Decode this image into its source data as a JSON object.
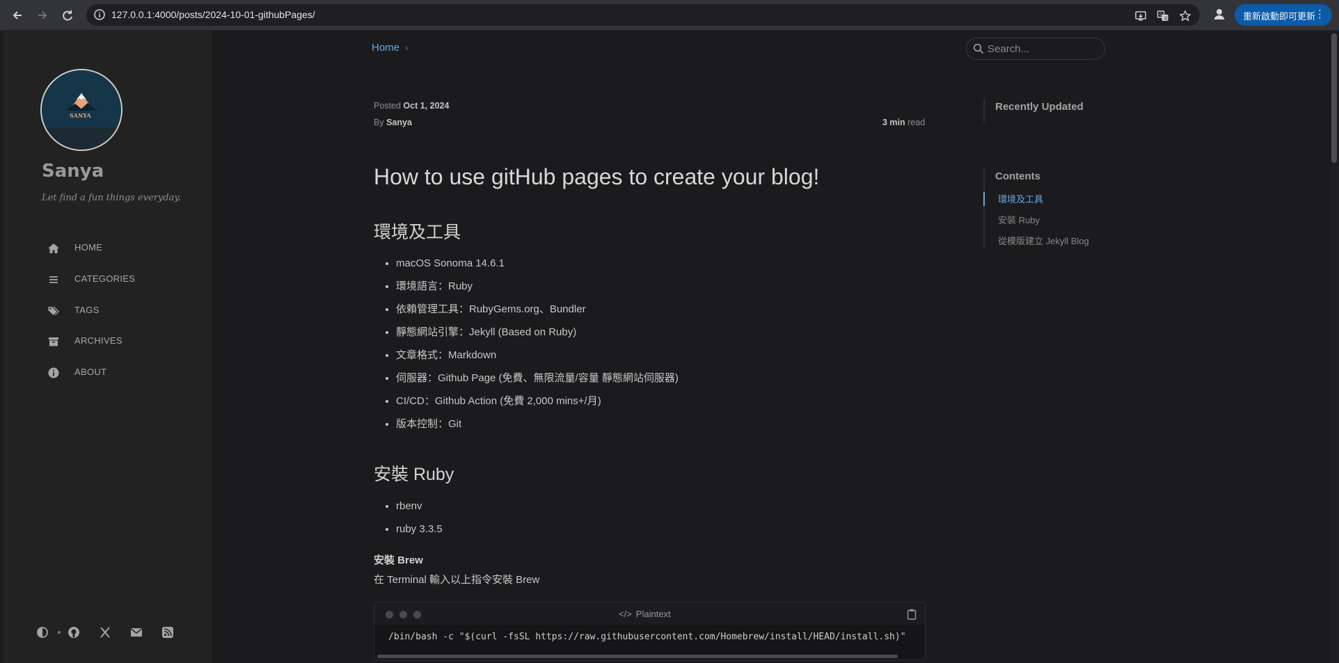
{
  "browser": {
    "url": "127.0.0.1:4000/posts/2024-10-01-githubPages/",
    "update_label": "重新啟動即可更新"
  },
  "sidebar": {
    "site_title": "Sanya",
    "subtitle": "Let find a fun things everyday.",
    "avatar_text": "SANYA",
    "menu": [
      {
        "label": "HOME",
        "icon": "home-icon"
      },
      {
        "label": "CATEGORIES",
        "icon": "list-icon"
      },
      {
        "label": "TAGS",
        "icon": "tags-icon"
      },
      {
        "label": "ARCHIVES",
        "icon": "archive-icon"
      },
      {
        "label": "ABOUT",
        "icon": "info-icon"
      }
    ],
    "social": [
      "theme-toggle-icon",
      "github-icon",
      "x-icon",
      "email-icon",
      "rss-icon"
    ]
  },
  "topbar": {
    "breadcrumb_home": "Home",
    "breadcrumb_sep": "›",
    "search_placeholder": "Search..."
  },
  "post": {
    "posted_label": "Posted",
    "posted_date": "Oct 1, 2024",
    "by_label": "By",
    "author": "Sanya",
    "read_time": "3 min",
    "read_label": "read",
    "title": "How to use gitHub pages to create your blog!",
    "section1_title": "環境及工具",
    "section1_items": [
      "macOS Sonoma 14.6.1",
      "環境語言：Ruby",
      "依賴管理工具：RubyGems.org、Bundler",
      "靜態網站引擎：Jekyll (Based on Ruby)",
      "文章格式：Markdown",
      "伺服器：Github Page (免費、無限流量/容量 靜態網站伺服器)",
      "CI/CD：Github Action (免費 2,000 mins+/月)",
      "版本控制：Git"
    ],
    "section2_title": "安裝 Ruby",
    "section2_items": [
      "rbenv",
      "ruby 3.3.5"
    ],
    "subsection_title": "安裝 Brew",
    "subsection_text": "在 Terminal 輸入以上指令安裝 Brew",
    "code_lang": "Plaintext",
    "code_line": "/bin/bash -c \"$(curl -fsSL https://raw.githubusercontent.com/Homebrew/install/HEAD/install.sh)\""
  },
  "panel": {
    "recent_title": "Recently Updated",
    "toc_title": "Contents",
    "toc_items": [
      "環境及工具",
      "安裝 Ruby",
      "從模版建立 Jekyll Blog"
    ]
  },
  "colors": {
    "accent": "#6aa8e0",
    "background": "#1b1b1e",
    "sidebar": "#222223",
    "update_button": "#0c5ba8"
  }
}
